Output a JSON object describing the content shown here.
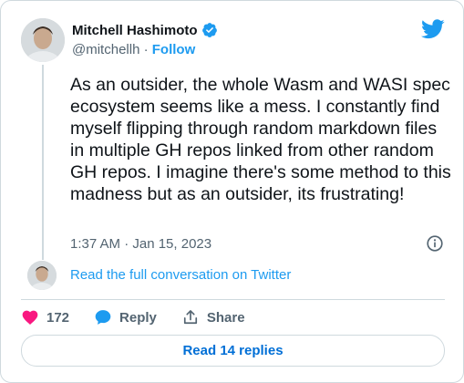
{
  "author": {
    "name": "Mitchell Hashimoto",
    "handle": "@mitchellh",
    "separator": " · ",
    "follow_label": "Follow"
  },
  "tweet": {
    "text": "As an outsider, the whole Wasm and WASI spec ecosystem seems like a mess. I constantly find myself flipping through random markdown files in multiple GH repos linked from other random GH repos. I imagine there's some method to this madness but as an outsider, its frustrating!",
    "timestamp": "1:37 AM · Jan 15, 2023"
  },
  "conversation": {
    "read_full_label": "Read the full conversation on Twitter"
  },
  "actions": {
    "like_count": "172",
    "reply_label": "Reply",
    "share_label": "Share"
  },
  "footer": {
    "read_replies_label": "Read 14 replies"
  },
  "colors": {
    "accent": "#1d9bf0",
    "like": "#f91880",
    "text": "#0f1419",
    "muted": "#536471",
    "border": "#cfd9de"
  },
  "icons": [
    "verified-badge-icon",
    "twitter-bird-icon",
    "info-icon",
    "heart-icon",
    "reply-bubble-icon",
    "share-icon"
  ]
}
